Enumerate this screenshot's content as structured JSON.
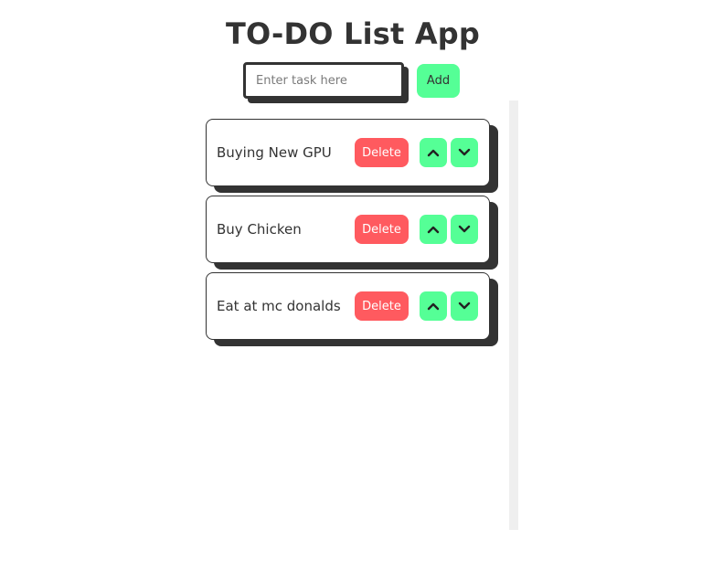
{
  "app": {
    "title": "TO-DO List App"
  },
  "form": {
    "input_value": "",
    "input_placeholder": "Enter task here",
    "add_label": "Add"
  },
  "tasks": [
    {
      "text": "Buying New GPU",
      "delete_label": "Delete",
      "up_icon": "chevron-up-icon",
      "down_icon": "chevron-down-icon"
    },
    {
      "text": "Buy Chicken",
      "delete_label": "Delete",
      "up_icon": "chevron-up-icon",
      "down_icon": "chevron-down-icon"
    },
    {
      "text": "Eat at mc donalds",
      "delete_label": "Delete",
      "up_icon": "chevron-up-icon",
      "down_icon": "chevron-down-icon"
    }
  ],
  "colors": {
    "text": "#333333",
    "accent_green": "#55ff96",
    "delete_red": "#ff5a5f",
    "scroll_track": "#efefef"
  }
}
